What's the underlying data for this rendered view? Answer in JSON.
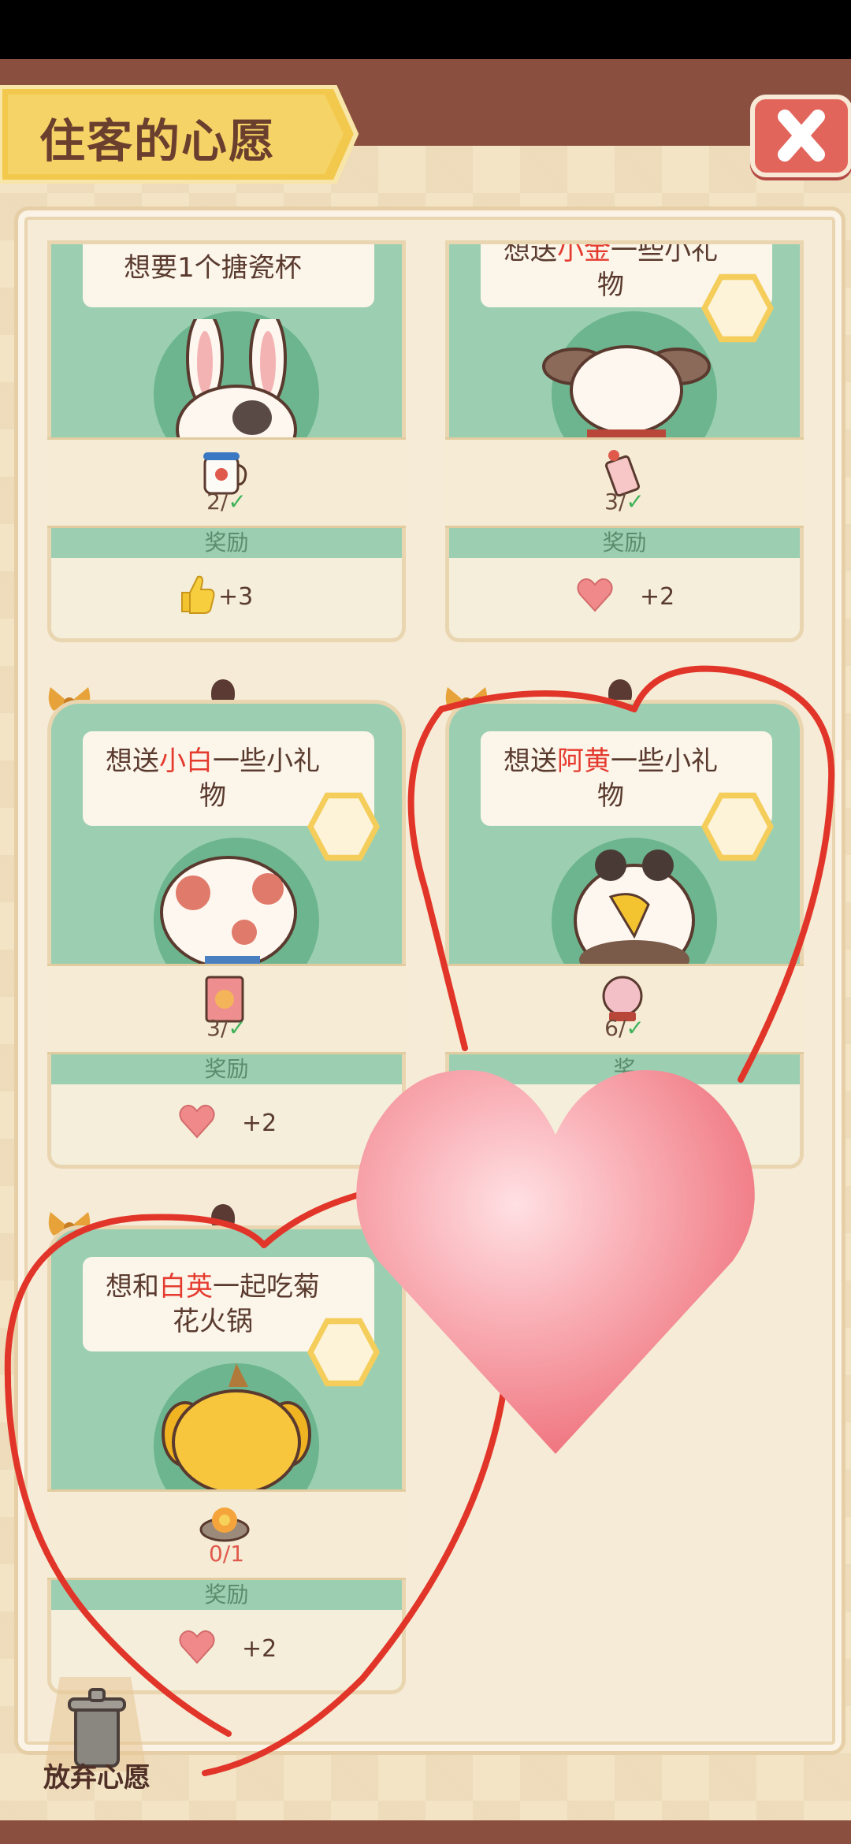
{
  "header": {
    "title": "住客的心愿",
    "close_icon": "close-x-icon"
  },
  "wishes": [
    {
      "text": "想要1个搪瓷杯",
      "item_icon": "enamel-mug-icon",
      "progress": "2/",
      "completed": true,
      "reward_label": "奖励",
      "reward_icon": "thumbs-up-icon",
      "reward_amount": "+3",
      "character": "rabbit-character"
    },
    {
      "text_pre": "想送",
      "text_name": "小金",
      "text_post": "一些小礼物",
      "item_icon": "pendant-icon",
      "progress": "3/",
      "completed": true,
      "reward_label": "奖励",
      "reward_icon": "heart-icon",
      "reward_amount": "+2",
      "character": "dog-character"
    },
    {
      "text_pre": "想送",
      "text_name": "小白",
      "text_post": "一些小礼物",
      "item_icon": "cat-gift-bag-icon",
      "progress": "3/",
      "completed": true,
      "reward_label": "奖励",
      "reward_icon": "heart-icon",
      "reward_amount": "+2",
      "character": "spotted-cat-character"
    },
    {
      "text_pre": "想送",
      "text_name": "阿黄",
      "text_post": "一些小礼物",
      "item_icon": "snow-globe-icon",
      "progress": "6/",
      "completed": true,
      "reward_label": "奖",
      "reward_icon": "heart-icon",
      "reward_amount": "",
      "character": "eagle-character"
    },
    {
      "text_pre": "想和",
      "text_name": "白英",
      "text_post": "一起吃菊花火锅",
      "item_icon": "chrysanthemum-hotpot-icon",
      "progress": "0/1",
      "completed": false,
      "reward_label": "奖励",
      "reward_icon": "heart-icon",
      "reward_amount": "+2",
      "character": "yellow-dog-character"
    }
  ],
  "footer": {
    "abandon_label": "放弃心愿",
    "abandon_icon": "trash-can-icon"
  },
  "colors": {
    "accent_red": "#e53b2f",
    "card_green": "#9ccfb2",
    "overlay_heart": "#f7909a",
    "drawing_stroke": "#e2352a"
  }
}
